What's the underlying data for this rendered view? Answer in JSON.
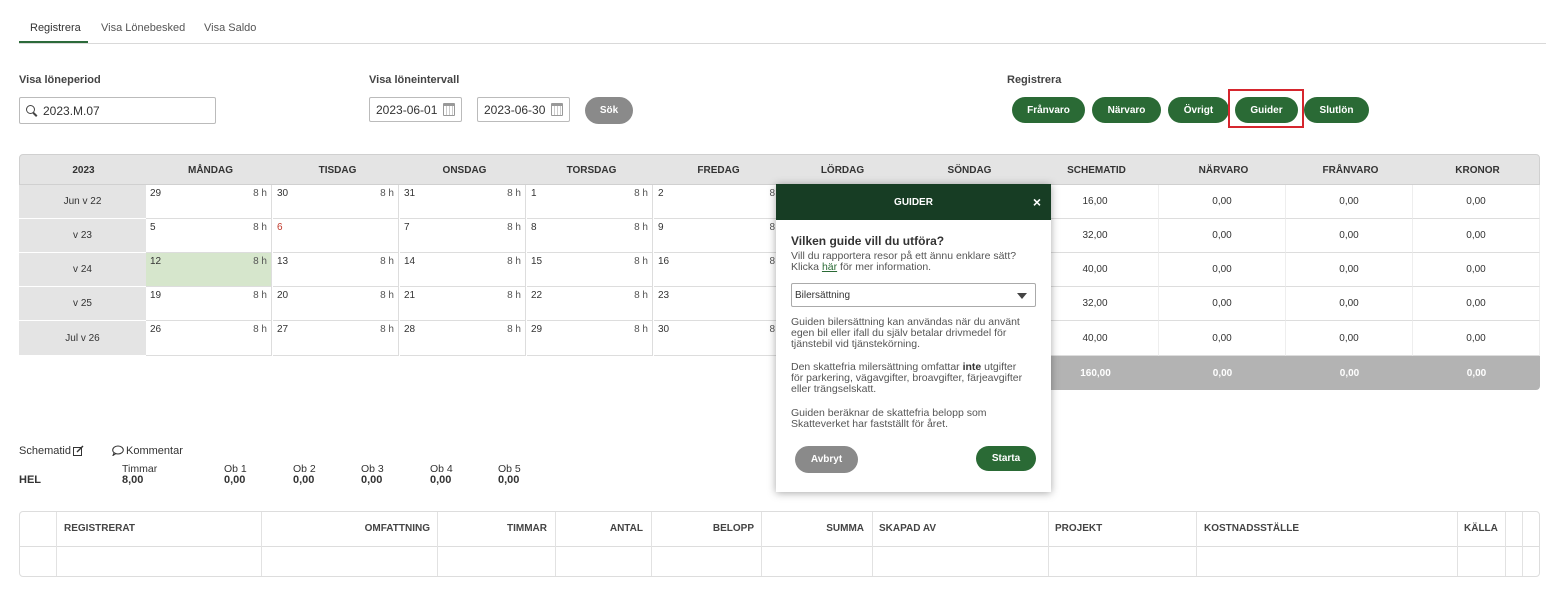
{
  "tabs": [
    "Registrera",
    "Visa Lönebesked",
    "Visa Saldo"
  ],
  "filters": {
    "period_label": "Visa löneperiod",
    "period_value": "2023.M.07",
    "interval_label": "Visa löneintervall",
    "date_from": "2023-06-01",
    "date_to": "2023-06-30",
    "search_button": "Sök",
    "register_label": "Registrera"
  },
  "register_buttons": [
    "Frånvaro",
    "Närvaro",
    "Övrigt",
    "Guider",
    "Slutlön"
  ],
  "calendar": {
    "year": "2023",
    "day_headers": [
      "MÅNDAG",
      "TISDAG",
      "ONSDAG",
      "TORSDAG",
      "FREDAG",
      "LÖRDAG",
      "SÖNDAG"
    ],
    "sum_headers": [
      "SCHEMATID",
      "NÄRVARO",
      "FRÅNVARO",
      "KRONOR"
    ],
    "weeks": [
      {
        "label": "Jun v 22",
        "days": [
          {
            "d": "29",
            "h": "8 h"
          },
          {
            "d": "30",
            "h": "8 h"
          },
          {
            "d": "31",
            "h": "8 h"
          },
          {
            "d": "1",
            "h": "8 h"
          },
          {
            "d": "2",
            "h": "8"
          }
        ],
        "sums": [
          "16,00",
          "0,00",
          "0,00",
          "0,00"
        ]
      },
      {
        "label": "v 23",
        "days": [
          {
            "d": "5",
            "h": "8 h"
          },
          {
            "d": "6",
            "h": ""
          },
          {
            "d": "7",
            "h": "8 h"
          },
          {
            "d": "8",
            "h": "8 h"
          },
          {
            "d": "9",
            "h": "8"
          }
        ],
        "sums": [
          "32,00",
          "0,00",
          "0,00",
          "0,00"
        ]
      },
      {
        "label": "v 24",
        "days": [
          {
            "d": "12",
            "h": "8 h"
          },
          {
            "d": "13",
            "h": "8 h"
          },
          {
            "d": "14",
            "h": "8 h"
          },
          {
            "d": "15",
            "h": "8 h"
          },
          {
            "d": "16",
            "h": "8"
          }
        ],
        "sums": [
          "40,00",
          "0,00",
          "0,00",
          "0,00"
        ]
      },
      {
        "label": "v 25",
        "days": [
          {
            "d": "19",
            "h": "8 h"
          },
          {
            "d": "20",
            "h": "8 h"
          },
          {
            "d": "21",
            "h": "8 h"
          },
          {
            "d": "22",
            "h": "8 h"
          },
          {
            "d": "23",
            "h": ""
          }
        ],
        "sums": [
          "32,00",
          "0,00",
          "0,00",
          "0,00"
        ]
      },
      {
        "label": "Jul v 26",
        "days": [
          {
            "d": "26",
            "h": "8 h"
          },
          {
            "d": "27",
            "h": "8 h"
          },
          {
            "d": "28",
            "h": "8 h"
          },
          {
            "d": "29",
            "h": "8 h"
          },
          {
            "d": "30",
            "h": "8"
          }
        ],
        "sums": [
          "40,00",
          "0,00",
          "0,00",
          "0,00"
        ]
      }
    ],
    "totals": [
      "160,00",
      "0,00",
      "0,00",
      "0,00"
    ]
  },
  "schedule": {
    "schematid_label": "Schematid",
    "comment_label": "Kommentar",
    "type": "HEL",
    "columns": [
      {
        "label": "Timmar",
        "value": "8,00"
      },
      {
        "label": "Ob 1",
        "value": "0,00"
      },
      {
        "label": "Ob 2",
        "value": "0,00"
      },
      {
        "label": "Ob 3",
        "value": "0,00"
      },
      {
        "label": "Ob 4",
        "value": "0,00"
      },
      {
        "label": "Ob 5",
        "value": "0,00"
      }
    ]
  },
  "grid_headers": [
    "REGISTRERAT",
    "OMFATTNING",
    "TIMMAR",
    "ANTAL",
    "BELOPP",
    "SUMMA",
    "SKAPAD AV",
    "PROJEKT",
    "KOSTNADSSTÄLLE",
    "KÄLLA"
  ],
  "modal": {
    "title": "GUIDER",
    "close": "×",
    "question": "Vilken guide vill du utföra?",
    "intro_line1": "Vill du rapportera resor på ett ännu enklare sätt?",
    "intro_pre": "Klicka ",
    "intro_link": "här",
    "intro_post": " för mer information.",
    "select_value": "Bilersättning",
    "desc1_l1": "Guiden bilersättning kan användas när du använt",
    "desc1_l2": "egen bil eller ifall du själv betalar drivmedel för",
    "desc1_l3": "tjänstebil vid tjänstekörning.",
    "desc2_pre": "Den skattefria milersättning omfattar ",
    "desc2_bold": "inte",
    "desc2_post": " utgifter",
    "desc2_l2": "för parkering, vägavgifter, broavgifter, färjeavgifter",
    "desc2_l3": "eller trängselskatt.",
    "desc3_l1": "Guiden beräknar de skattefria belopp som",
    "desc3_l2": "Skatteverket har fastställt för året.",
    "cancel": "Avbryt",
    "start": "Starta"
  }
}
